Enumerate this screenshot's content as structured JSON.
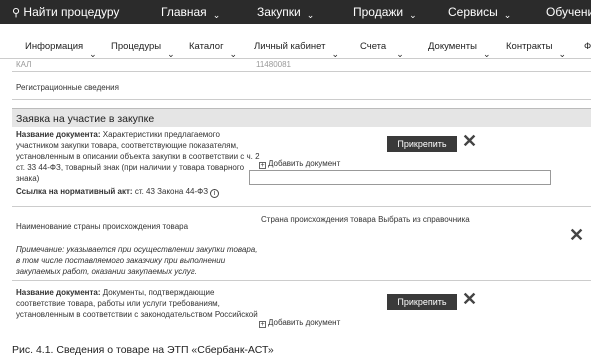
{
  "topnav": {
    "search": "Найти процедуру",
    "main": "Главная",
    "purchases": "Закупки",
    "sales": "Продажи",
    "services": "Сервисы",
    "learning": "Обучение"
  },
  "subnav": [
    "Информация",
    "Процедуры",
    "Каталог",
    "Личный кабинет",
    "Счета",
    "Документы",
    "Контракты",
    "Ф"
  ],
  "top_cut": {
    "left": "КАЛ",
    "right": "11480081"
  },
  "registration": "Регистрационные сведения",
  "section_title": "Заявка на участие в закупке",
  "doc1": {
    "label": "Название документа:",
    "lines": [
      "Характеристики предлагаемого",
      "участником закупки товара, соответствующие показателям,",
      "установленным в описании объекта закупки в соответствии с ч. 2",
      "ст. 33 44-ФЗ, товарный знак (при наличии у товара товарного",
      "знака)"
    ],
    "norm_label": "Ссылка на нормативный акт:",
    "norm_value": "ст. 43 Закона 44-ФЗ",
    "info_icon": "i",
    "add": "Добавить документ",
    "attach": "Прикрепить",
    "remove": "✕"
  },
  "country": {
    "label": "Наименование страны происхождения товара",
    "field_label": "Страна происхождения товара",
    "pick": "Выбрать из справочника",
    "note": [
      "Примечание: указывается при осуществлении закупки товара,",
      "в том числе поставляемого заказчику при выполнении",
      "закупаемых работ, оказании закупаемых услуг."
    ],
    "remove": "✕"
  },
  "doc2": {
    "label": "Название документа:",
    "lines": [
      "Документы, подтверждающие",
      "соответствие товара, работы или услуги требованиям,",
      "установленным в соответствии с законодательством Российской"
    ],
    "add": "Добавить документ",
    "attach": "Прикрепить",
    "remove": "✕"
  },
  "caption": "Рис. 4.1. Сведения о товаре на ЭТП «Сбербанк-АСТ»"
}
